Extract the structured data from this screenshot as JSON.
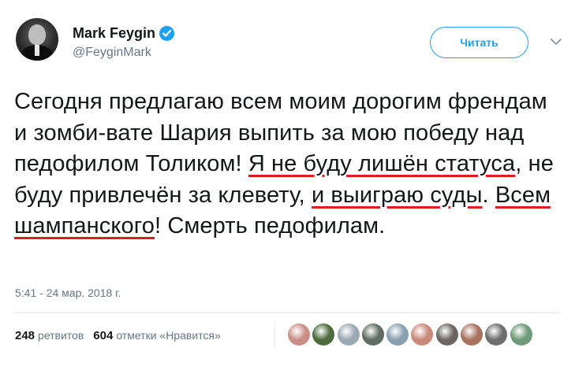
{
  "author": {
    "display_name": "Mark Feygin",
    "handle": "@FeyginMark",
    "verified": true
  },
  "follow_button_label": "Читать",
  "tweet": {
    "segments": [
      "Сегодня предлагаю всем моим дорогим френдам и зомби-вате Шария выпить за мою победу над педофилом Толиком! ",
      "Я не буду лишён статуса",
      ", не буду привлечён за клевету, ",
      "и выиграю суды",
      ". ",
      "Всем шампанского",
      "! Смерть педофилам."
    ],
    "underline_color": "#d8211b"
  },
  "timestamp": "5:41 - 24 мар. 2018 г.",
  "stats": {
    "retweets_count": "248",
    "retweets_label": "ретвитов",
    "likes_count": "604",
    "likes_label": "отметки «Нравится»"
  },
  "likers": [
    {
      "color": "#c98f86"
    },
    {
      "color": "#4d6b3c"
    },
    {
      "color": "#9aa9b4"
    },
    {
      "color": "#5f6d63"
    },
    {
      "color": "#8aa0b1"
    },
    {
      "color": "#c88a7a"
    },
    {
      "color": "#6b6660"
    },
    {
      "color": "#a9715f"
    },
    {
      "color": "#6e6e6e"
    },
    {
      "color": "#6d9a77"
    }
  ],
  "colors": {
    "accent": "#1da1f2",
    "secondary_text": "#657786"
  }
}
